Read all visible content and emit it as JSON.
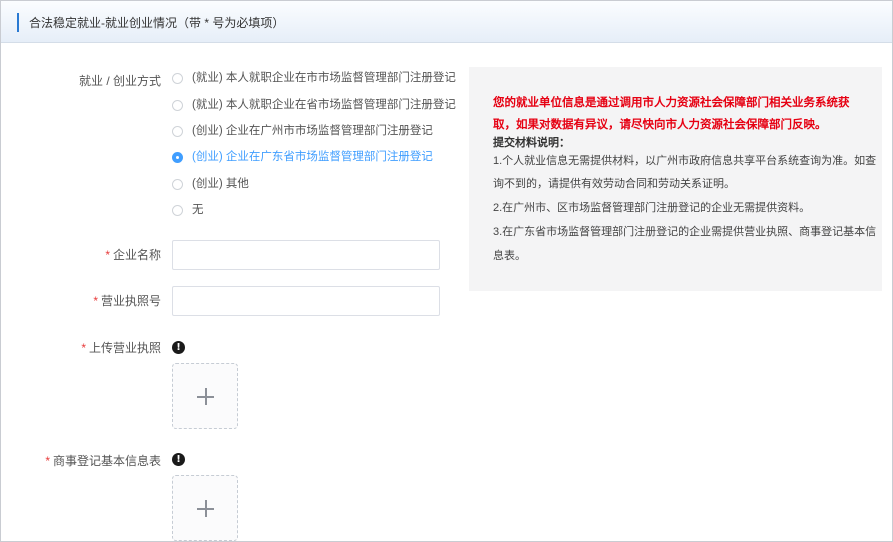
{
  "header": {
    "title": "合法稳定就业-就业创业情况（带 * 号为必填项）"
  },
  "employment_type": {
    "label": "就业 / 创业方式",
    "selected_index": 3,
    "options": [
      "(就业) 本人就职企业在市市场监督管理部门注册登记",
      "(就业) 本人就职企业在省市场监督管理部门注册登记",
      "(创业) 企业在广州市市场监督管理部门注册登记",
      "(创业) 企业在广东省市场监督管理部门注册登记",
      "(创业) 其他",
      "无"
    ]
  },
  "company_name": {
    "required_mark": "*",
    "label": "企业名称",
    "value": ""
  },
  "license_number": {
    "required_mark": "*",
    "label": "营业执照号",
    "value": ""
  },
  "upload_license": {
    "required_mark": "*",
    "label": "上传营业执照",
    "icon": "exclamation-circle-icon",
    "plus_icon": "plus-icon"
  },
  "upload_registration": {
    "required_mark": "*",
    "label": "商事登记基本信息表",
    "icon": "exclamation-circle-icon",
    "plus_icon": "plus-icon"
  },
  "info": {
    "red_notice": "您的就业单位信息是通过调用市人力资源社会保障部门相关业务系统获取，如果对数据有异议，请尽快向市人力资源社会保障部门反映。",
    "heading": "提交材料说明：",
    "lines": [
      "1.个人就业信息无需提供材料，以广州市政府信息共享平台系统查询为准。如查",
      "询不到的，请提供有效劳动合同和劳动关系证明。",
      "2.在广州市、区市场监督管理部门注册登记的企业无需提供资料。",
      "3.在广东省市场监督管理部门注册登记的企业需提供营业执照、商事登记基本信",
      "息表。"
    ]
  },
  "colors": {
    "accent": "#2a7ad2",
    "selected": "#409eff",
    "required": "#e83a3a",
    "notice_red": "#e60012",
    "info_bg": "#f4f4f5"
  }
}
